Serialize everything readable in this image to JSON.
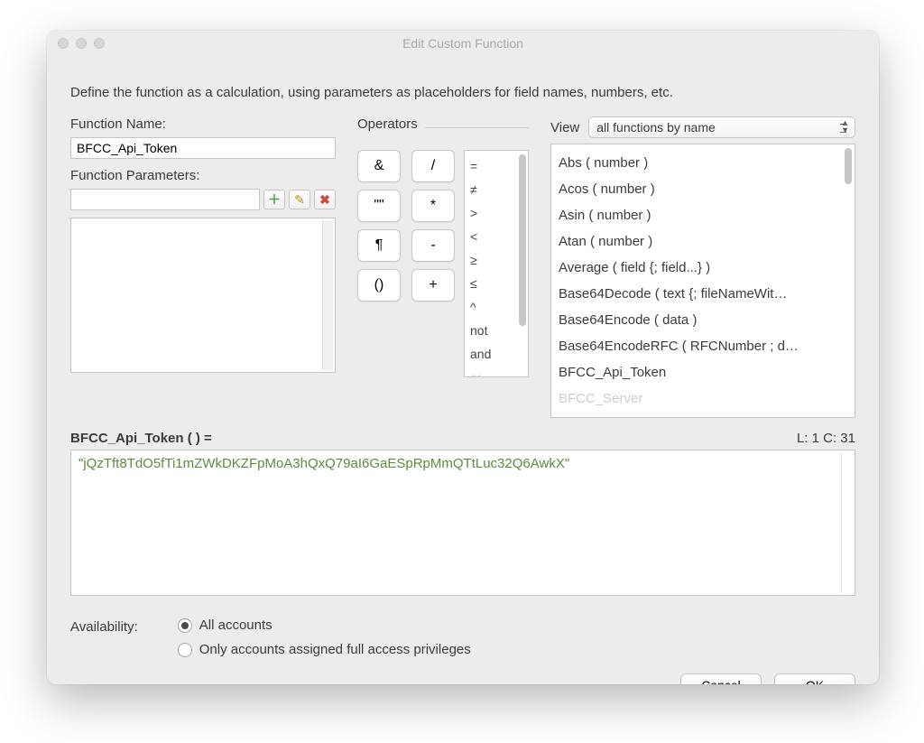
{
  "window": {
    "title": "Edit Custom Function"
  },
  "instruction": "Define the function as a calculation, using parameters as placeholders for field names, numbers, etc.",
  "labels": {
    "function_name": "Function Name:",
    "function_parameters": "Function Parameters:",
    "operators": "Operators",
    "view": "View",
    "availability": "Availability:"
  },
  "function_name_value": "BFCC_Api_Token",
  "parameter_value": "",
  "operators": {
    "grid": [
      "&",
      "/",
      "\"\"",
      "*",
      "¶",
      "-",
      "()",
      "+"
    ],
    "symbols": [
      "=",
      "≠",
      ">",
      "<",
      "≥",
      "≤",
      "^",
      "not",
      "and",
      "or"
    ]
  },
  "view_select": "all functions by name",
  "functions": [
    "Abs ( number )",
    "Acos ( number )",
    "Asin ( number )",
    "Atan ( number )",
    "Average ( field {; field...} )",
    "Base64Decode ( text {; fileNameWit…",
    "Base64Encode ( data )",
    "Base64EncodeRFC ( RFCNumber ; d…",
    "BFCC_Api_Token",
    "BFCC_Server"
  ],
  "formula": {
    "signature": "BFCC_Api_Token (  ) =",
    "position": "L: 1 C: 31",
    "body": "\"jQzTft8TdO5fTi1mZWkDKZFpMoA3hQxQ79aI6GaESpRpMmQTtLuc32Q6AwkX\""
  },
  "availability": {
    "options": [
      "All accounts",
      "Only accounts assigned full access privileges"
    ],
    "selected_index": 0
  },
  "buttons": {
    "cancel": "Cancel",
    "ok": "OK"
  },
  "icons": {
    "plus": "＋",
    "pencil": "✎",
    "delete": "✖"
  }
}
